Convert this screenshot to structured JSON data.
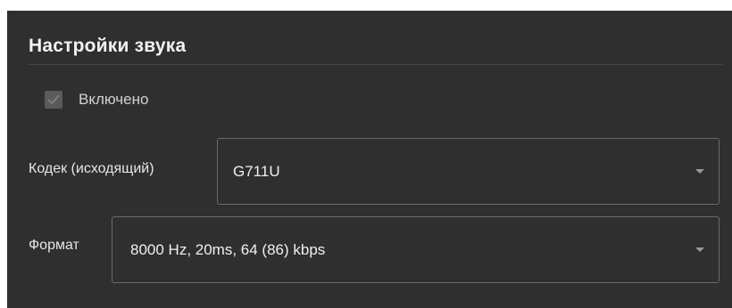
{
  "section": {
    "title": "Настройки звука"
  },
  "enabled": {
    "label": "Включено",
    "checked": true
  },
  "codec": {
    "label": "Кодек (исходящий)",
    "value": "G711U"
  },
  "format": {
    "label": "Формат",
    "value": "8000 Hz, 20ms, 64 (86) kbps"
  },
  "icons": {
    "checkbox": "checkmark-icon",
    "dropdown": "chevron-down-icon"
  },
  "colors": {
    "panel_background": "#2f2f2f",
    "text": "#f0f0f0",
    "border": "#6a6a6a",
    "checkbox_disabled": "#5a5a5a"
  }
}
